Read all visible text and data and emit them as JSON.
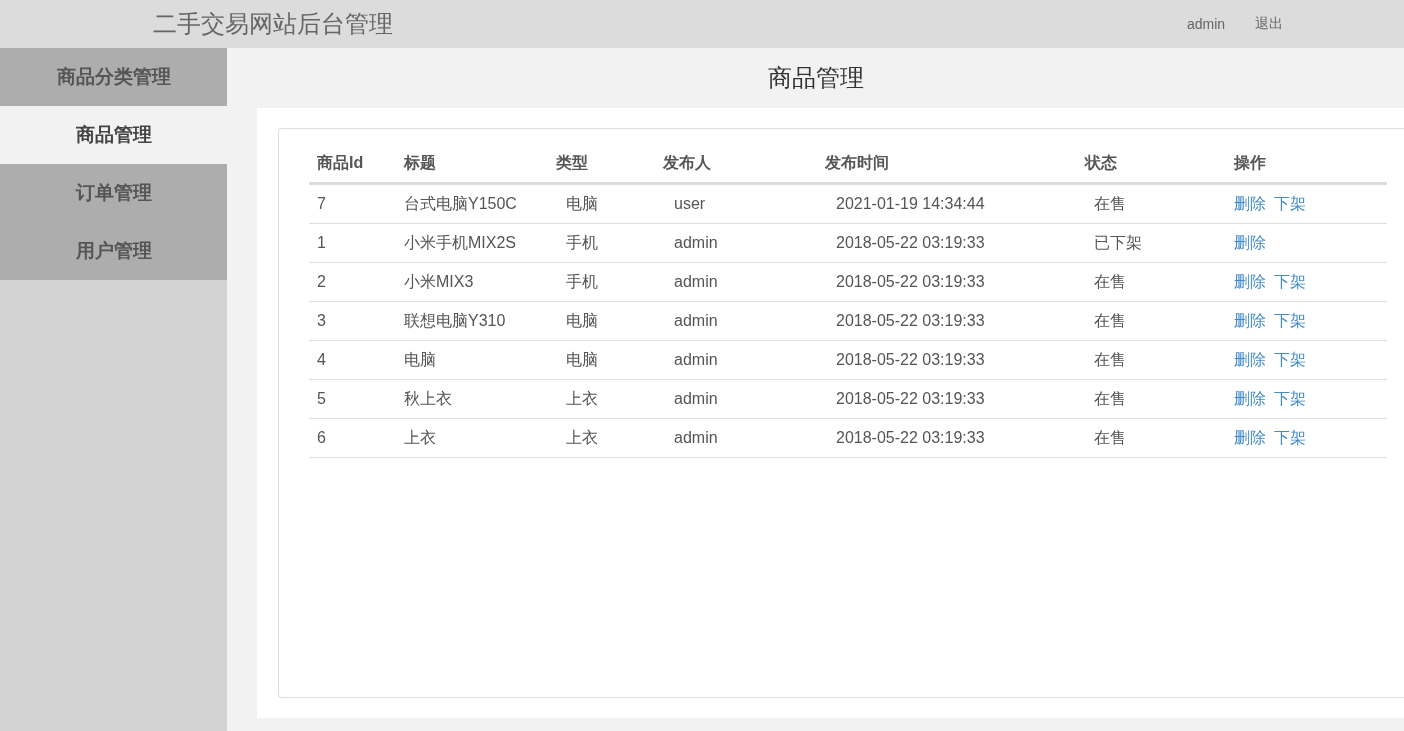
{
  "header": {
    "title": "二手交易网站后台管理",
    "user": "admin",
    "logout": "退出"
  },
  "sidebar": {
    "items": [
      {
        "label": "商品分类管理",
        "selected": false
      },
      {
        "label": "商品管理",
        "selected": true
      },
      {
        "label": "订单管理",
        "selected": false
      },
      {
        "label": "用户管理",
        "selected": false
      }
    ]
  },
  "page_title": "商品管理",
  "table": {
    "columns": [
      "商品Id",
      "标题",
      "类型",
      "发布人",
      "发布时间",
      "状态",
      "操作"
    ],
    "rows": [
      {
        "cells": [
          "7",
          "台式电脑Y150C",
          "电脑",
          "user",
          "2021-01-19 14:34:44",
          "在售"
        ],
        "actions": [
          "删除",
          "下架"
        ]
      },
      {
        "cells": [
          "1",
          "小米手机MIX2S",
          "手机",
          "admin",
          "2018-05-22 03:19:33",
          "已下架"
        ],
        "actions": [
          "删除"
        ]
      },
      {
        "cells": [
          "2",
          "小米MIX3",
          "手机",
          "admin",
          "2018-05-22 03:19:33",
          "在售"
        ],
        "actions": [
          "删除",
          "下架"
        ]
      },
      {
        "cells": [
          "3",
          "联想电脑Y310",
          "电脑",
          "admin",
          "2018-05-22 03:19:33",
          "在售"
        ],
        "actions": [
          "删除",
          "下架"
        ]
      },
      {
        "cells": [
          "4",
          "电脑",
          "电脑",
          "admin",
          "2018-05-22 03:19:33",
          "在售"
        ],
        "actions": [
          "删除",
          "下架"
        ]
      },
      {
        "cells": [
          "5",
          "秋上衣",
          "上衣",
          "admin",
          "2018-05-22 03:19:33",
          "在售"
        ],
        "actions": [
          "删除",
          "下架"
        ]
      },
      {
        "cells": [
          "6",
          "上衣",
          "上衣",
          "admin",
          "2018-05-22 03:19:33",
          "在售"
        ],
        "actions": [
          "删除",
          "下架"
        ]
      }
    ]
  }
}
